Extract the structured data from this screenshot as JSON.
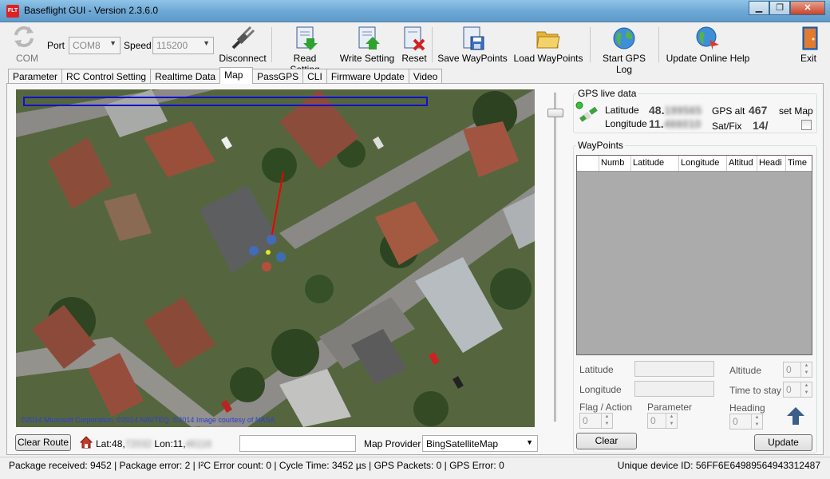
{
  "window": {
    "title": "Baseflight GUI - Version 2.3.6.0",
    "icon_text": "FLT",
    "minimize": "▁",
    "maximize": "❐",
    "close": "✕"
  },
  "toolbar": {
    "com_label": "COM",
    "port_label": "Port",
    "port_value": "COM8",
    "speed_label": "Speed",
    "speed_value": "115200",
    "disconnect": "Disconnect",
    "read_setting": "Read Setting",
    "write_setting": "Write Setting",
    "reset": "Reset",
    "save_waypoints": "Save WayPoints",
    "load_waypoints": "Load WayPoints",
    "start_gps_log": "Start GPS Log",
    "update_online_help": "Update Online Help",
    "exit": "Exit"
  },
  "tabs": [
    {
      "label": "Parameter",
      "active": false
    },
    {
      "label": "RC Control Setting",
      "active": false
    },
    {
      "label": "Realtime Data",
      "active": false
    },
    {
      "label": "Map",
      "active": true
    },
    {
      "label": "PassGPS",
      "active": false
    },
    {
      "label": "CLI",
      "active": false
    },
    {
      "label": "Firmware Update",
      "active": false
    },
    {
      "label": "Video",
      "active": false
    }
  ],
  "map": {
    "copyright": "©2014 Microsoft Corporation, ©2014 NAVTEQ, ©2014 Image courtesy of NASA",
    "clear_route": "Clear Route",
    "lat_prefix": "Lat:48,",
    "lat_hidden": "72032",
    "lon_prefix": "Lon:11,",
    "lon_hidden": "46116",
    "provider_label": "Map Provider",
    "provider_value": "BingSatelliteMap"
  },
  "gps_live": {
    "title": "GPS live data",
    "latitude_label": "Latitude",
    "latitude_prefix": "48.",
    "latitude_hidden": "199565",
    "longitude_label": "Longitude",
    "longitude_prefix": "11.",
    "longitude_hidden": "466010",
    "alt_label": "GPS alt",
    "alt_value": "467",
    "satfix_label": "Sat/Fix",
    "satfix_value": "14/",
    "set_map_label": "set Map"
  },
  "waypoints": {
    "title": "WayPoints",
    "columns": [
      "",
      "Numb",
      "Latitude",
      "Longitude",
      "Altitud",
      "Headi",
      "Time"
    ],
    "latitude_label": "Latitude",
    "longitude_label": "Longitude",
    "altitude_label": "Altitude",
    "altitude_value": "0",
    "time_to_stay_label": "Time to stay",
    "time_to_stay_value": "0",
    "flag_action_label": "Flag / Action",
    "flag_action_value": "0",
    "parameter_label": "Parameter",
    "parameter_value": "0",
    "heading_label": "Heading",
    "heading_value": "0",
    "clear": "Clear",
    "update": "Update"
  },
  "status": {
    "left": "Package received:  9452  |  Package error:  2  |  I²C Error count:  0  |  Cycle Time:  3452 µs  |  GPS Packets: 0   |  GPS Error: 0",
    "right": "Unique device ID:   56FF6E64989564943312487"
  }
}
